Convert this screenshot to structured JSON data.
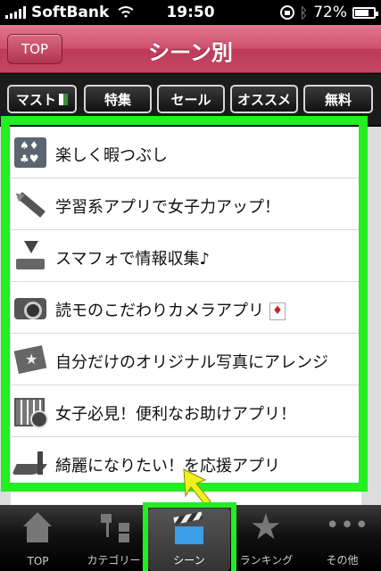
{
  "status_bar": {
    "carrier": "SoftBank",
    "time": "19:50",
    "battery": "72%"
  },
  "header": {
    "top_button": "TOP",
    "title": "シーン別"
  },
  "tabs": [
    {
      "label": "マスト"
    },
    {
      "label": "特集"
    },
    {
      "label": "セール"
    },
    {
      "label": "オススメ"
    },
    {
      "label": "無料"
    }
  ],
  "list": {
    "items": [
      {
        "label": "楽しく暇つぶし",
        "icon": "playing-cards-icon"
      },
      {
        "label": "学習系アプリで女子力アップ！",
        "icon": "pencil-icon"
      },
      {
        "label": "スマフォで情報収集♪",
        "icon": "download-tray-icon"
      },
      {
        "label": "読モのこだわりカメラアプリ",
        "icon": "camera-icon"
      },
      {
        "label": "自分だけのオリジナル写真にアレンジ",
        "icon": "photo-frame-icon"
      },
      {
        "label": "女子必見！便利なお助けアプリ！",
        "icon": "calendar-clock-icon"
      },
      {
        "label": "綺麗になりたい！を応援アプリ",
        "icon": "high-heel-icon"
      }
    ]
  },
  "tabbar": {
    "items": [
      {
        "label": "TOP",
        "icon": "home-icon"
      },
      {
        "label": "カテゴリー",
        "icon": "category-tree-icon"
      },
      {
        "label": "シーン",
        "icon": "clapperboard-icon"
      },
      {
        "label": "ランキング",
        "icon": "star-icon"
      },
      {
        "label": "その他",
        "icon": "more-dots-icon"
      }
    ],
    "selected": "シーン"
  },
  "colors": {
    "header_pink": "#cf4f6d",
    "highlight_green": "#22ee22",
    "arrow_yellow": "#f2ef1e"
  }
}
